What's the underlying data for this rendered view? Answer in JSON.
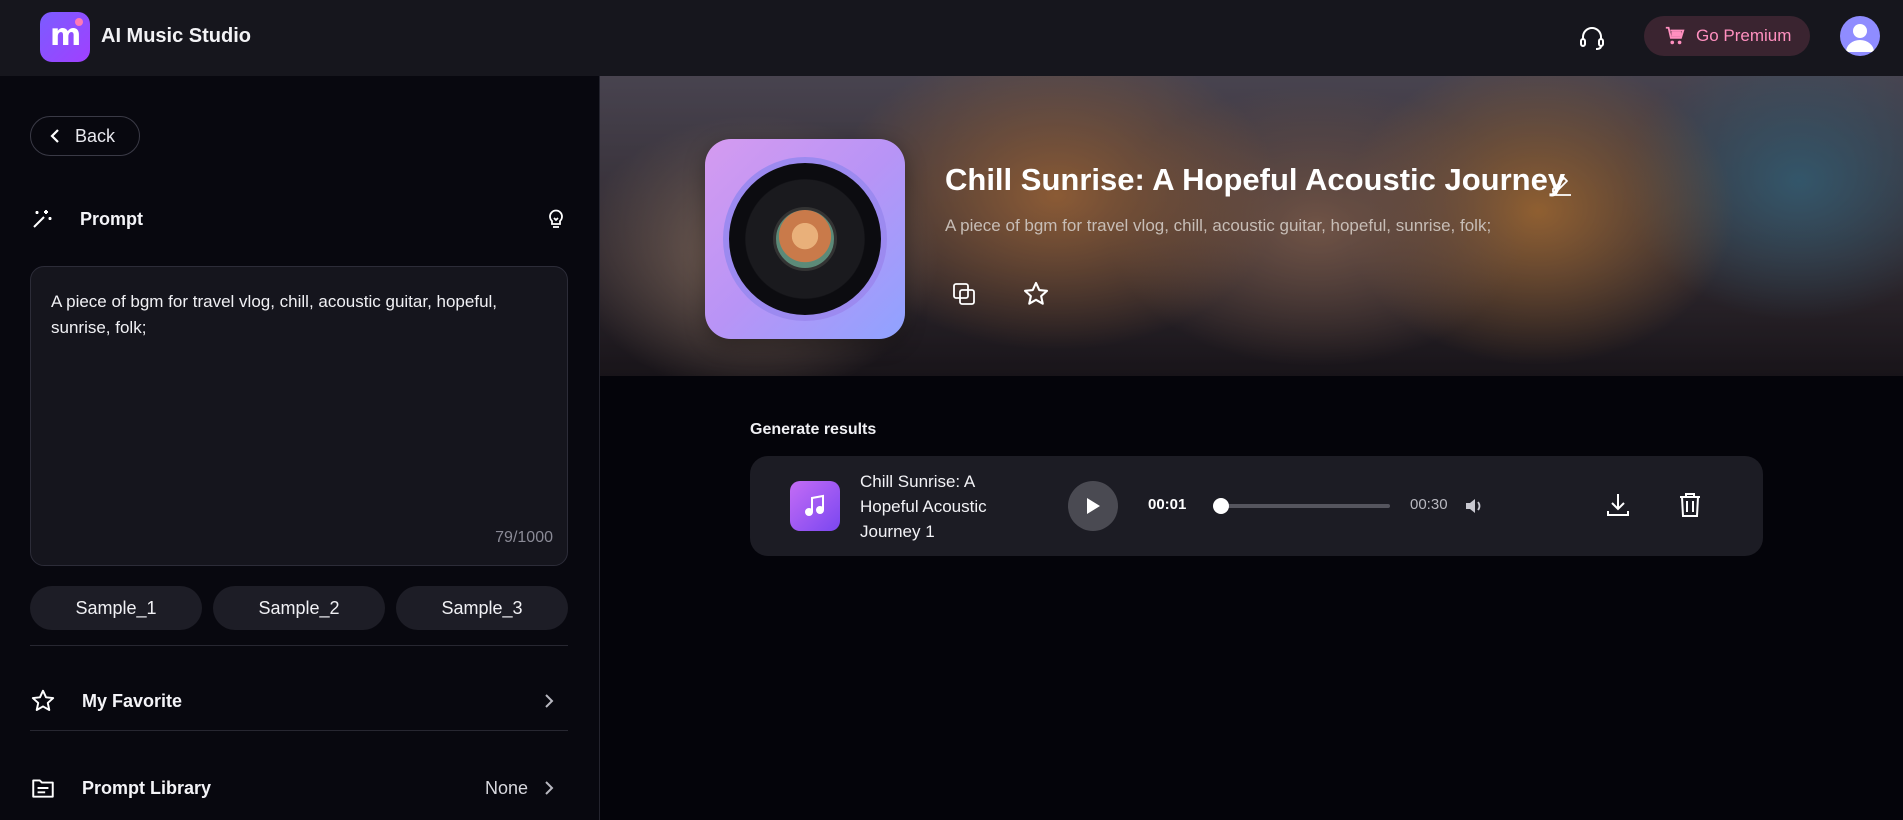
{
  "app": {
    "title": "AI Music Studio",
    "logo_letter": "m"
  },
  "header": {
    "premium_label": "Go Premium"
  },
  "left_panel": {
    "back_label": "Back",
    "prompt_label": "Prompt",
    "prompt_text": "A piece of bgm for travel vlog, chill, acoustic guitar, hopeful, sunrise, folk;",
    "char_count": "79/1000",
    "samples": [
      "Sample_1",
      "Sample_2",
      "Sample_3"
    ],
    "favorite_label": "My Favorite",
    "library_label": "Prompt Library",
    "library_value": "None"
  },
  "hero": {
    "title": "Chill Sunrise: A Hopeful Acoustic Journey",
    "description": "A piece of bgm for travel vlog, chill, acoustic guitar, hopeful, sunrise, folk;"
  },
  "results": {
    "heading": "Generate results",
    "items": [
      {
        "name": "Chill Sunrise: A Hopeful Acoustic Journey 1",
        "current_time": "00:01",
        "total_time": "00:30",
        "progress": 0.033
      }
    ]
  },
  "colors": {
    "premium_text": "#ff8fbf",
    "accent": "#8a5cff",
    "background": "#04040a"
  }
}
